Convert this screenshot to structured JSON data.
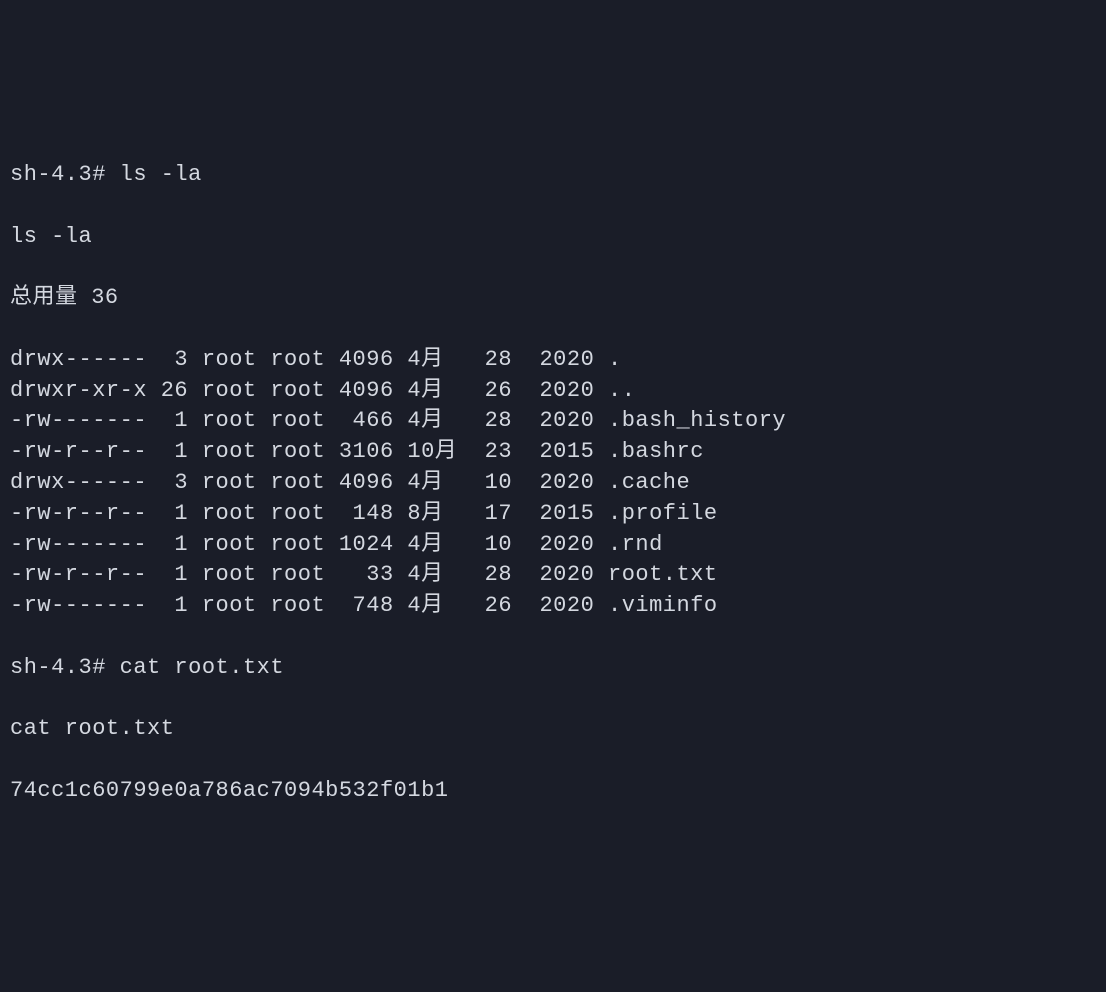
{
  "terminal": {
    "line1_prompt": "sh-4.3# ",
    "line1_cmd": "ls -la",
    "line2": "ls -la",
    "line3": "总用量 36",
    "files": [
      {
        "perms": "drwx------",
        "links": " 3",
        "owner": "root",
        "group": "root",
        "size": "4096",
        "month": "4月 ",
        "day": " 28",
        "year": " 2020",
        "name": "."
      },
      {
        "perms": "drwxr-xr-x",
        "links": "26",
        "owner": "root",
        "group": "root",
        "size": "4096",
        "month": "4月 ",
        "day": " 26",
        "year": " 2020",
        "name": ".."
      },
      {
        "perms": "-rw-------",
        "links": " 1",
        "owner": "root",
        "group": "root",
        "size": " 466",
        "month": "4月 ",
        "day": " 28",
        "year": " 2020",
        "name": ".bash_history"
      },
      {
        "perms": "-rw-r--r--",
        "links": " 1",
        "owner": "root",
        "group": "root",
        "size": "3106",
        "month": "10月",
        "day": " 23",
        "year": " 2015",
        "name": ".bashrc"
      },
      {
        "perms": "drwx------",
        "links": " 3",
        "owner": "root",
        "group": "root",
        "size": "4096",
        "month": "4月 ",
        "day": " 10",
        "year": " 2020",
        "name": ".cache"
      },
      {
        "perms": "-rw-r--r--",
        "links": " 1",
        "owner": "root",
        "group": "root",
        "size": " 148",
        "month": "8月 ",
        "day": " 17",
        "year": " 2015",
        "name": ".profile"
      },
      {
        "perms": "-rw-------",
        "links": " 1",
        "owner": "root",
        "group": "root",
        "size": "1024",
        "month": "4月 ",
        "day": " 10",
        "year": " 2020",
        "name": ".rnd"
      },
      {
        "perms": "-rw-r--r--",
        "links": " 1",
        "owner": "root",
        "group": "root",
        "size": "  33",
        "month": "4月 ",
        "day": " 28",
        "year": " 2020",
        "name": "root.txt"
      },
      {
        "perms": "-rw-------",
        "links": " 1",
        "owner": "root",
        "group": "root",
        "size": " 748",
        "month": "4月 ",
        "day": " 26",
        "year": " 2020",
        "name": ".viminfo"
      }
    ],
    "cat_prompt": "sh-4.3# ",
    "cat_cmd": "cat root.txt",
    "cat_echo": "cat root.txt",
    "cat_output": "74cc1c60799e0a786ac7094b532f01b1"
  }
}
